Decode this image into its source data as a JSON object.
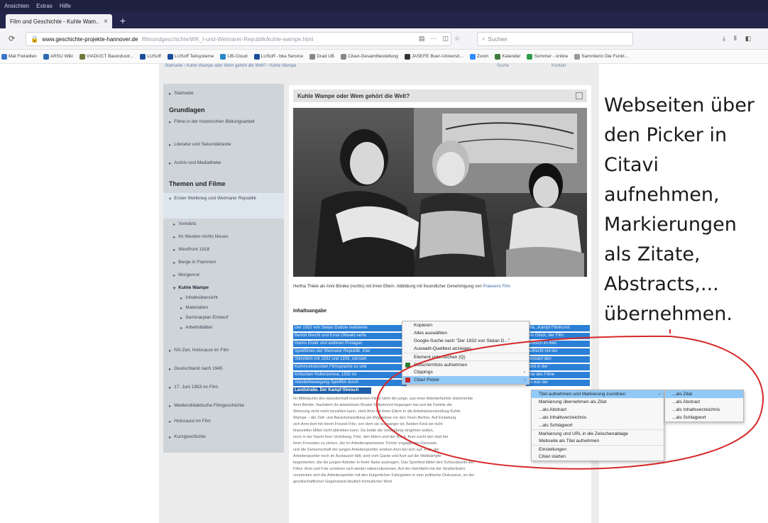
{
  "browser": {
    "menu_items": [
      "Ansichten",
      "Extras",
      "Hilfe"
    ],
    "tab_title": "Film und Geschichte - Kuhle Wam...",
    "tab_close": "×",
    "new_tab": "+",
    "url_domain": "www.geschichte-projekte-hannover.de",
    "url_path": "/filmundgeschichte/WK_I-und-Weimarer-Republik/kuhle-wampe.html",
    "search_placeholder": "Suchen",
    "bookmarks": [
      {
        "label": "Mal Freiwillen",
        "color": "#3a78c9"
      },
      {
        "label": "ARSU Wiki",
        "color": "#2b6cb0"
      },
      {
        "label": "VIADUCT Bauindustr...",
        "color": "#6b7a3a"
      },
      {
        "label": "LUSoff",
        "color": "#1c4f9a"
      },
      {
        "label": "LUSoff Teilsysteme",
        "color": "#1c4f9a"
      },
      {
        "label": "UB-Cloud",
        "color": "#2a86c8"
      },
      {
        "label": "LUSoff - bka Service",
        "color": "#1c4f9a"
      },
      {
        "label": "Drad UB",
        "color": "#888888"
      },
      {
        "label": "Citavi-Gesamtbestellung",
        "color": "#888888"
      },
      {
        "label": "JASEFE Buer-Universit...",
        "color": "#333333"
      },
      {
        "label": "Zoom",
        "color": "#2d8cff"
      },
      {
        "label": "Kalender",
        "color": "#3d7a3d"
      },
      {
        "label": "Sommer - online",
        "color": "#2e9e4a"
      },
      {
        "label": "Sammlerin Die Funkt...",
        "color": "#999999"
      }
    ]
  },
  "page": {
    "breadcrumb": "Startseite › Kuhle Wampe oder Wem gehört die Welt? › Kuhle Wampe",
    "crumb_right": [
      "Suche",
      "Kontakt"
    ],
    "sidebar": {
      "top_item": "Startseite",
      "heading1": "Grundlagen",
      "group1": [
        "Filme in der historischen Bildungsarbeit",
        "Literatur und Sekundärtexte",
        "Archiv und Mediatheke"
      ],
      "heading2": "Themen und Filme",
      "active_item": "Erster Weltkrieg und Weimarer Republik",
      "group2": [
        "Vorwärts",
        "Im Westen nichts Neues",
        "Westfront 1918",
        "Berge in Flammen",
        "Morgenrot"
      ],
      "current": "Kuhle Wampe",
      "sub_items": [
        "Inhaltsübersicht",
        "Materialien",
        "Seminarplan Entwurf",
        "Arbeitsblätter"
      ],
      "group3": [
        "NS-Zeit, Holocaust im Film",
        "Deutschland nach 1945",
        "17. Juni 1953 im Film",
        "Mediendidaktische Filmgeschichte",
        "Holocaust im Film",
        "Kurzgeschichte"
      ]
    },
    "article": {
      "title": "Kuhle Wampe oder Wem gehört die Welt?",
      "caption_line1": "Hertha Thiele als Anni Bönike (rechts) mit ihren Eltern. Abbildung mit freundlicher Genehmigung von",
      "caption_link": "Praesens Film",
      "subheading": "Inhaltsangabe",
      "highlight_left": [
        "Der 1932 von Slatan Dudow realisierte",
        "Bertolt Brecht und Ernst Ottwald verfa",
        "Hanns Eisler und anderen Protagon",
        "Spielfilmen der Weimarer Republik. Ebe",
        "Stilmitteln mit 1932 und 1933, zensiert",
        "Kommunistischen Filmsprache zu und",
        "Kritischen Rollenzensur, 1932 im",
        "Arbeiterbewegung-Spielfilm durch",
        "Landstraße. Der Kampf filmisch"
      ],
      "highlight_right": [
        "Wa...Kampf Filmkunst",
        "ein Glück, der Film",
        "filmisch im Bild",
        "aufrecht mit der",
        "zensiert den",
        "wird in der",
        "war des Filme",
        "es war der"
      ],
      "body_lines": [
        "Im Mittelpunkt des episodenhaft inszenierten Films steht die junge, aus einer Arbeiterfamilie stammende",
        "Anni Bönike. Nachdem ihr arbeitsloser Bruder Selbstmord begangen hat und die Familie die",
        "Wohnung nicht mehr bezahlen kann, zieht Anni mit ihren Eltern in die Arbeitslosensiedlung Kuhle",
        "Wampe – der Zelt- und Barackensiedlung am Müggelsee vor den Toren Berlins. Auf Einladung",
        "sich Anni dort mit ihrem Freund Fritz, von dem sie schwanger ist. Beiden Kind sei nicht",
        "finanzieller Mittel nicht abtreiben kann. Da beide die Verbindung eingehen wollen,",
        "noch in der Nacht ihrer Verlobung. Fritz, den Eltern und der Braut. Anni sucht den Halt bei",
        "ihren Freunden zu ziehen, der im Arbeitersportverein 'Fichte' engagierten Genossin",
        "und die Gemeinschaft der jungen Arbeitersportler erleben Anni bei sich auf. Fritz, der",
        "Arbeitersportler noch im Austausch fällt, wird vom Garde und Kurt auf die Wettkämpfe",
        "begeisterten, die die jungen Arbeiter in freier Natur austragen. Das Sportfest bildet den Schlusspunkt des",
        "Films. Anni und Fritz scheinen sich wieder näherzukommen. Auf der Heimfahrt mit der Straßenbahn",
        "verstricken sich die Arbeitersportler mit den bürgerlichen Fahrgästen in eine politische Diskussion, an der",
        "gesellschaftlichen Gegenstand deutlich formulierten Wort."
      ]
    }
  },
  "context_menu": {
    "items": [
      {
        "label": "Kopieren",
        "sub": ""
      },
      {
        "label": "Alles auswählen",
        "sub": ""
      },
      {
        "label": "Google-Suche nach \"Der 1932 von Slatan D...\"",
        "sub": ""
      },
      {
        "label": "Auswahl-Quelltext anzeigen",
        "sub": ""
      },
      {
        "label": "Element untersuchen (Q)",
        "sub": ""
      },
      {
        "label": "Bildschirmfoto aufnehmen",
        "sub": ""
      },
      {
        "label": "Clippings",
        "sub": "›"
      },
      {
        "label": "Citavi Picker",
        "sub": "›"
      }
    ],
    "citavi_submenu": [
      "Titel aufnehmen und Markierung zuordnen",
      "Markierung übernehmen als Zitat",
      "...als Abstract",
      "...als Inhaltsverzeichnis",
      "...als Schlagwort",
      "Markierung und URL in die Zwischenablage",
      "Webseite als Titel aufnehmen",
      "Einstellungen",
      "Citavi starten"
    ],
    "title_submenu": [
      "...als Zitat",
      "...als Abstract",
      "...als Inhaltsverzeichnis",
      "...als Schlagwort"
    ]
  },
  "annotation": {
    "lines": [
      "Webseiten über",
      "den Picker in",
      "Citavi",
      "aufnehmen,",
      "Markierungen",
      "als Zitate,",
      "Abstracts,...",
      "übernehmen."
    ],
    "oval_color": "#d62828"
  }
}
